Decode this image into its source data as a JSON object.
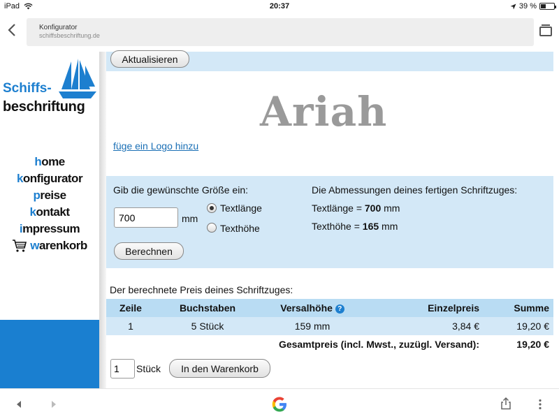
{
  "status": {
    "device": "iPad",
    "time": "20:37",
    "battery": "39 %",
    "battery_level": 0.39
  },
  "browser": {
    "page_title": "Konfigurator",
    "url": "schiffsbeschriftung.de"
  },
  "logo": {
    "line1": "Schiffs-",
    "line2": "beschriftung"
  },
  "nav": [
    {
      "first": "h",
      "rest": "ome"
    },
    {
      "first": "k",
      "rest": "onfigurator"
    },
    {
      "first": "p",
      "rest": "reise"
    },
    {
      "first": "k",
      "rest": "ontakt"
    },
    {
      "first": "i",
      "rest": "mpressum"
    },
    {
      "first": "w",
      "rest": "arenkorb"
    }
  ],
  "main": {
    "update_button": "Aktualisieren",
    "preview_text": "Ariah",
    "logo_link": "füge ein Logo hinzu",
    "size": {
      "prompt": "Gib die gewünschte Größe ein:",
      "value": "700",
      "unit": "mm",
      "option_length": "Textlänge",
      "option_height": "Texthöhe",
      "calc_button": "Berechnen",
      "dims_title": "Die Abmessungen deines fertigen Schriftzuges:",
      "length_label": "Textlänge = ",
      "length_value": "700",
      "height_label": "Texthöhe = ",
      "height_value": "165",
      "dims_unit": " mm"
    },
    "price": {
      "title": "Der berechnete Preis deines Schriftzuges:",
      "headers": [
        "Zeile",
        "Buchstaben",
        "Versalhöhe",
        "Einzelpreis",
        "Summe"
      ],
      "help_icon": "?",
      "row": [
        "1",
        "5 Stück",
        "159 mm",
        "3,84 €",
        "19,20 €"
      ],
      "total_label": "Gesamtpreis (incl. Mwst., zuzügl. Versand):",
      "total_value": "19,20 €"
    },
    "cart": {
      "qty": "1",
      "qty_unit": "Stück",
      "button": "In den Warenkorb"
    }
  }
}
